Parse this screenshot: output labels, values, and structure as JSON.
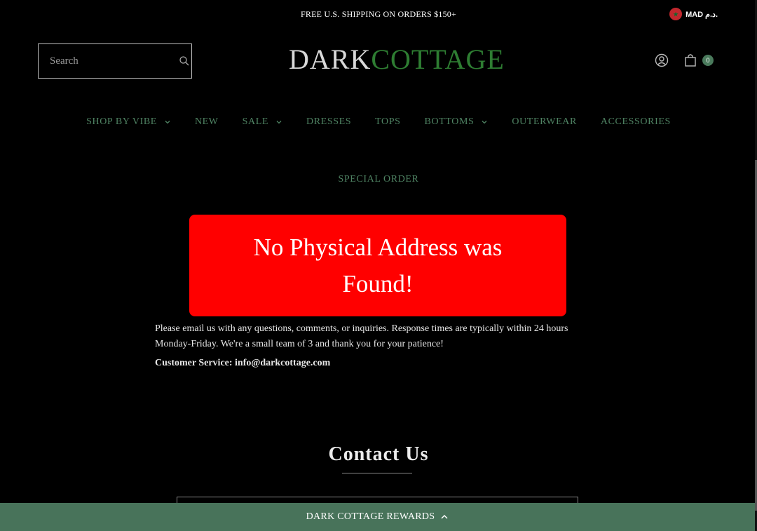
{
  "announcement": "FREE U.S. SHIPPING ON ORDERS $150+",
  "currency": {
    "label": "MAD د.م."
  },
  "search": {
    "placeholder": "Search"
  },
  "logo": {
    "dark": "DARK",
    "cottage": "COTTAGE"
  },
  "cart": {
    "count": "0"
  },
  "nav": {
    "items": [
      {
        "label": "SHOP BY VIBE"
      },
      {
        "label": "NEW"
      },
      {
        "label": "SALE"
      },
      {
        "label": "DRESSES"
      },
      {
        "label": "TOPS"
      },
      {
        "label": "BOTTOMS"
      },
      {
        "label": "OUTERWEAR"
      },
      {
        "label": "ACCESSORIES"
      },
      {
        "label": "SPECIAL ORDER"
      }
    ]
  },
  "alert": {
    "text": "No Physical Address was Found!"
  },
  "content": {
    "paragraph": "Please email us with any questions, comments, or inquiries. Response times are typically within 24 hours Monday-Friday. We're a small team of 3 and thank you for your patience!",
    "service": "Customer Service: info@darkcottage.com"
  },
  "contact": {
    "title": "Contact Us"
  },
  "rewards": {
    "label": "DARK COTTAGE REWARDS"
  },
  "colors": {
    "background": "#000000",
    "nav_green": "#4f8363",
    "alert_red": "#ff0000",
    "rewards_bar": "#48735a",
    "logo_green": "#2e7d32"
  }
}
